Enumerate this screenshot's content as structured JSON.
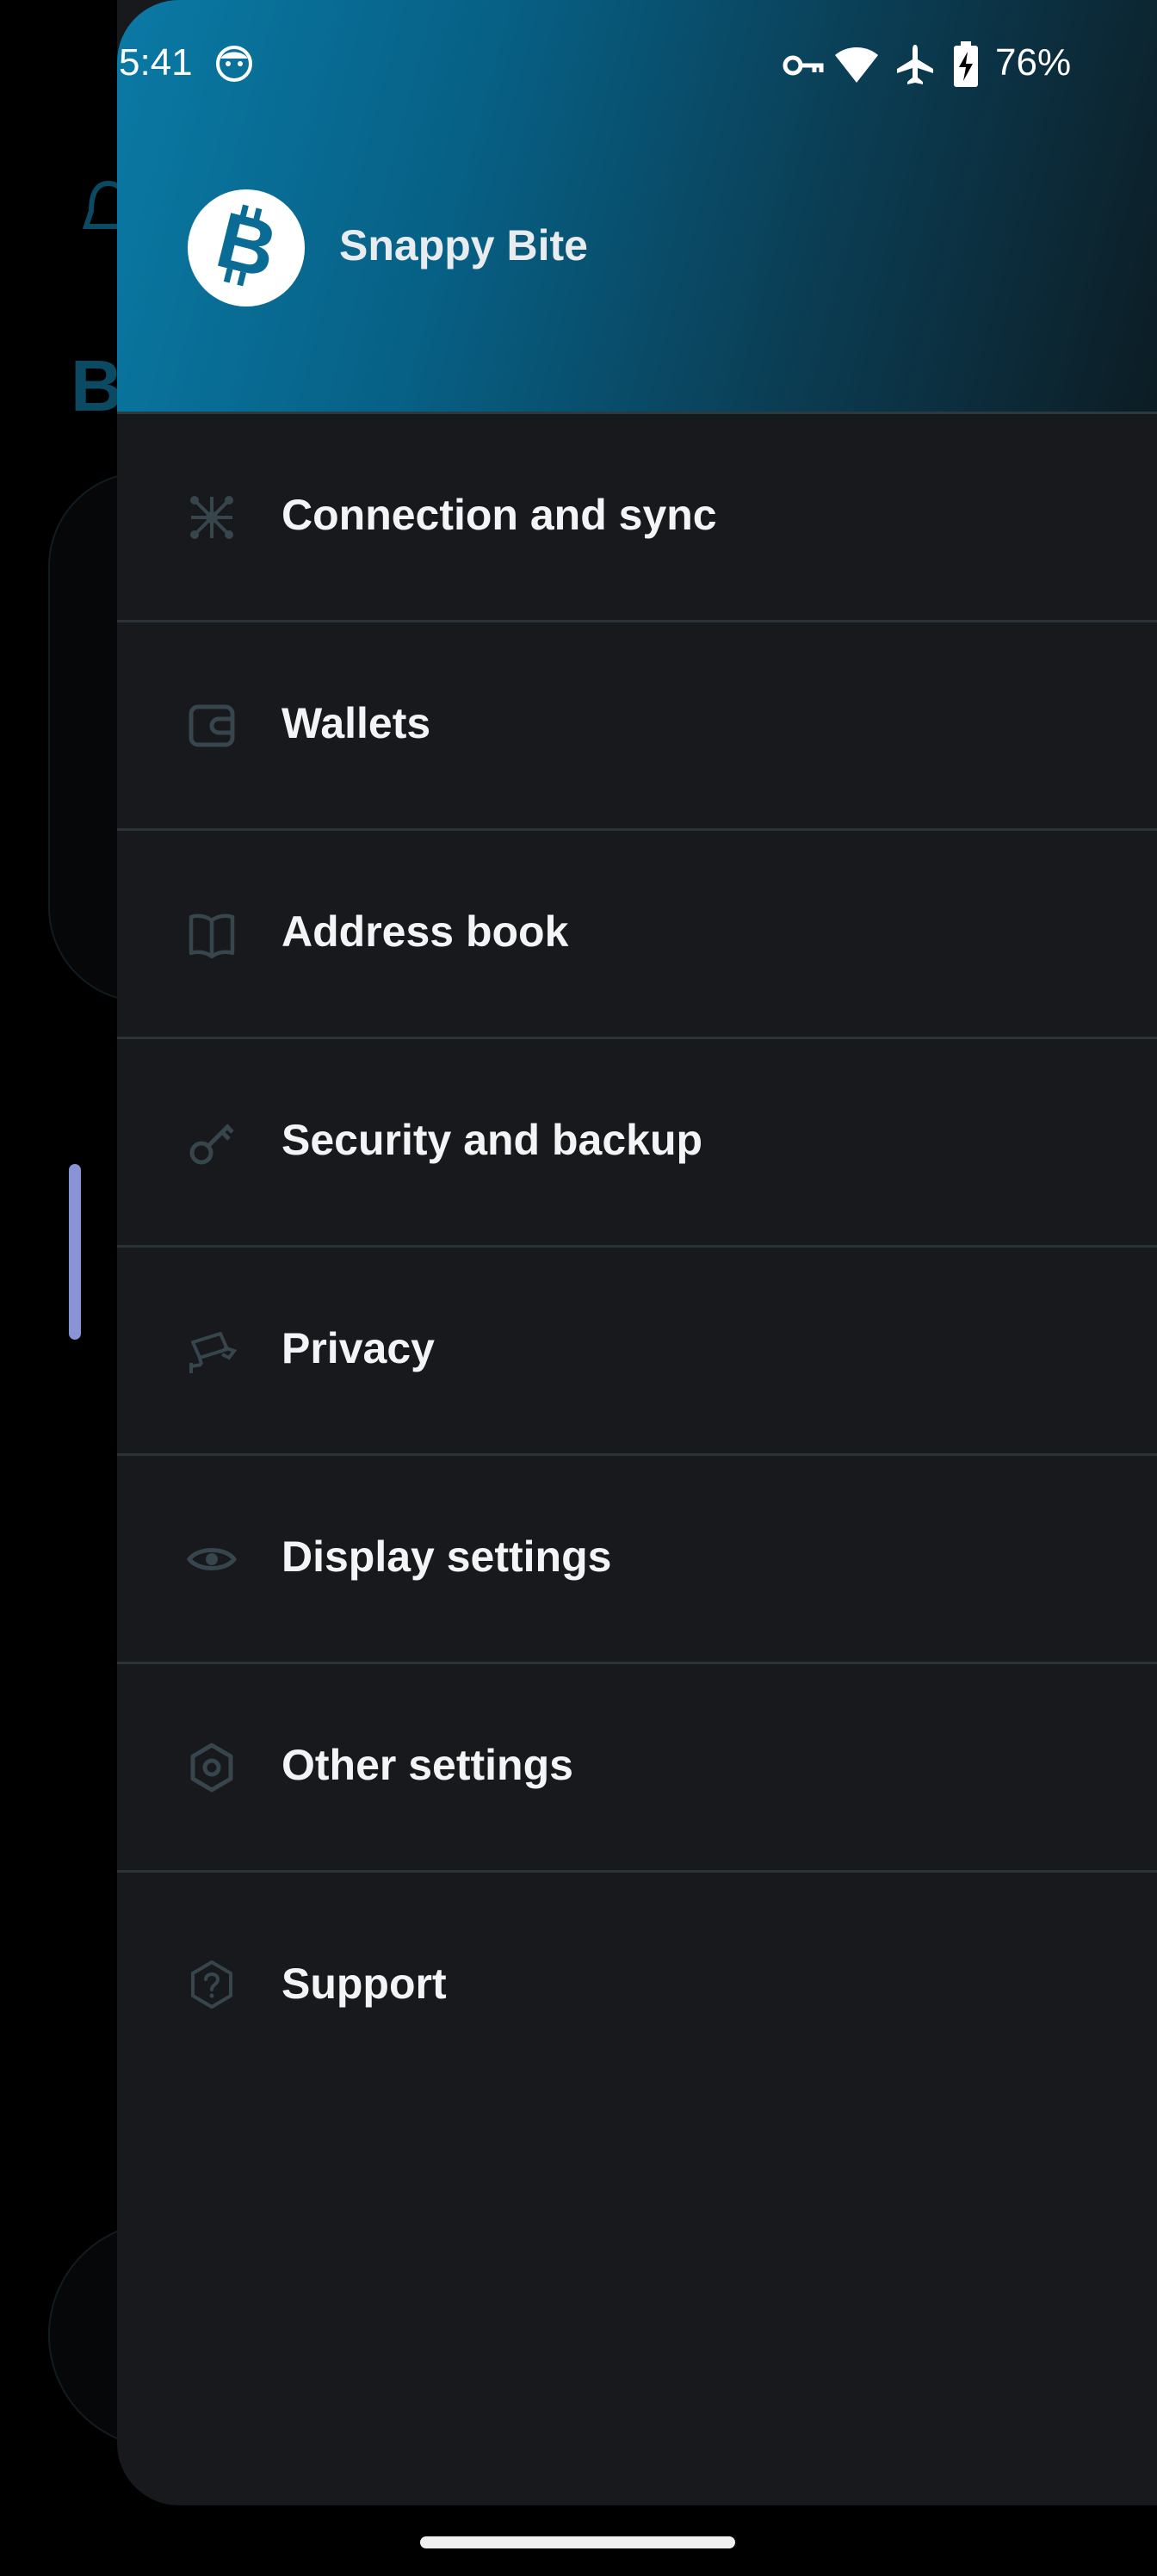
{
  "status_bar": {
    "time": "5:41",
    "battery": "76%",
    "icons": [
      "face-icon",
      "vpn-key-icon",
      "wifi-icon",
      "airplane-mode-icon",
      "battery-charging-icon"
    ]
  },
  "header": {
    "wallet_name": "Snappy Bite",
    "avatar_icon": "bitcoin-icon",
    "gradient_colors": [
      "#0a7aa5",
      "#0c1c24"
    ]
  },
  "menu": {
    "items": [
      {
        "label": "Connection and sync",
        "icon": "network-nodes-icon"
      },
      {
        "label": "Wallets",
        "icon": "wallet-icon"
      },
      {
        "label": "Address book",
        "icon": "book-icon"
      },
      {
        "label": "Security and backup",
        "icon": "key-icon"
      },
      {
        "label": "Privacy",
        "icon": "surveillance-camera-icon"
      },
      {
        "label": "Display settings",
        "icon": "eye-icon"
      },
      {
        "label": "Other settings",
        "icon": "hexagon-settings-icon"
      },
      {
        "label": "Support",
        "icon": "help-hexagon-icon"
      }
    ]
  },
  "background_app": {
    "visible_letter": "B"
  },
  "colors": {
    "drawer_bg": "#17191c",
    "divider": "#2c3338",
    "icon": "#37454d",
    "text": "#f2f4f5",
    "accent": "#0a7aa5"
  }
}
